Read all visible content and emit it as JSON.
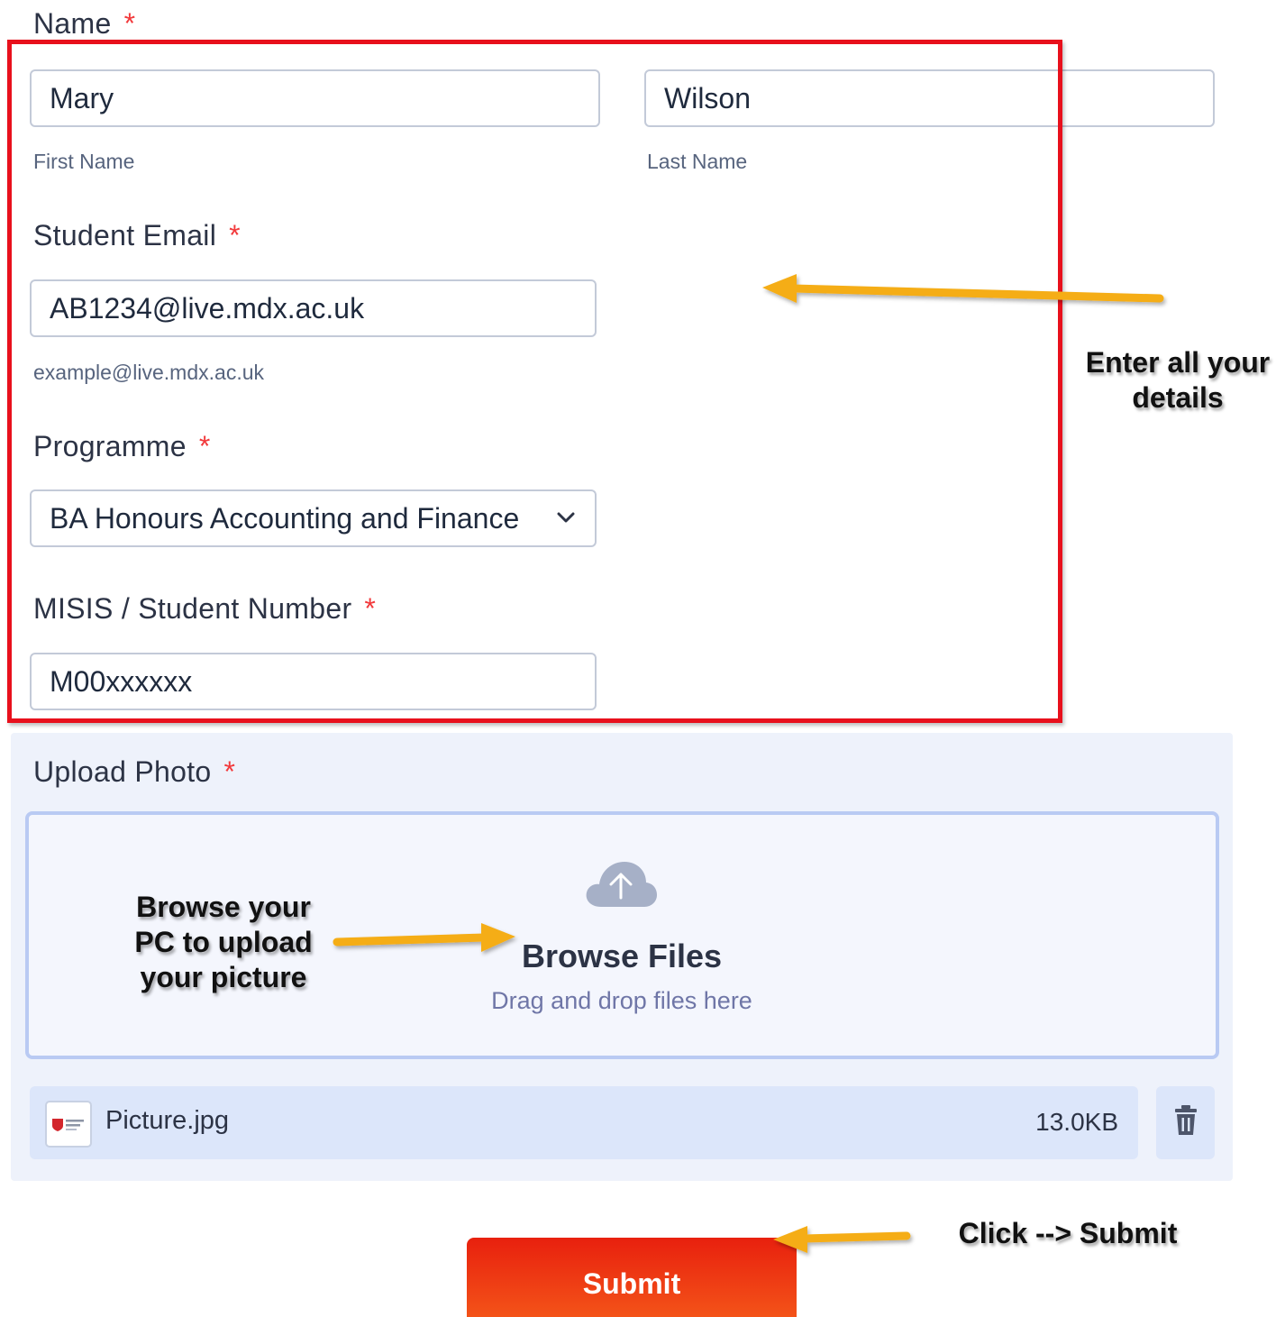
{
  "name": {
    "label": "Name",
    "required_mark": "*",
    "first_name": {
      "value": "Mary",
      "sublabel": "First Name"
    },
    "last_name": {
      "value": "Wilson",
      "sublabel": "Last Name"
    }
  },
  "student_email": {
    "label": "Student Email",
    "required_mark": "*",
    "value": "AB1234@live.mdx.ac.uk",
    "hint": "example@live.mdx.ac.uk"
  },
  "programme": {
    "label": "Programme",
    "required_mark": "*",
    "selected": "BA Honours Accounting and Finance"
  },
  "student_number": {
    "label": "MISIS / Student Number",
    "required_mark": "*",
    "value": "M00xxxxxx"
  },
  "upload": {
    "label": "Upload Photo",
    "required_mark": "*",
    "browse_title": "Browse Files",
    "browse_sub": "Drag and drop files here",
    "file": {
      "name": "Picture.jpg",
      "size": "13.0KB"
    }
  },
  "submit_label": "Submit",
  "annotations": {
    "enter_details": [
      "Enter all your",
      "details"
    ],
    "browse_pc": [
      "Browse your",
      "PC to upload",
      "your picture"
    ],
    "click_submit": "Click --> Submit"
  },
  "colors": {
    "highlight_border": "#e8101c",
    "arrow": "#f5ad14",
    "required": "#f23a3c",
    "submit": "#ee3a14"
  }
}
